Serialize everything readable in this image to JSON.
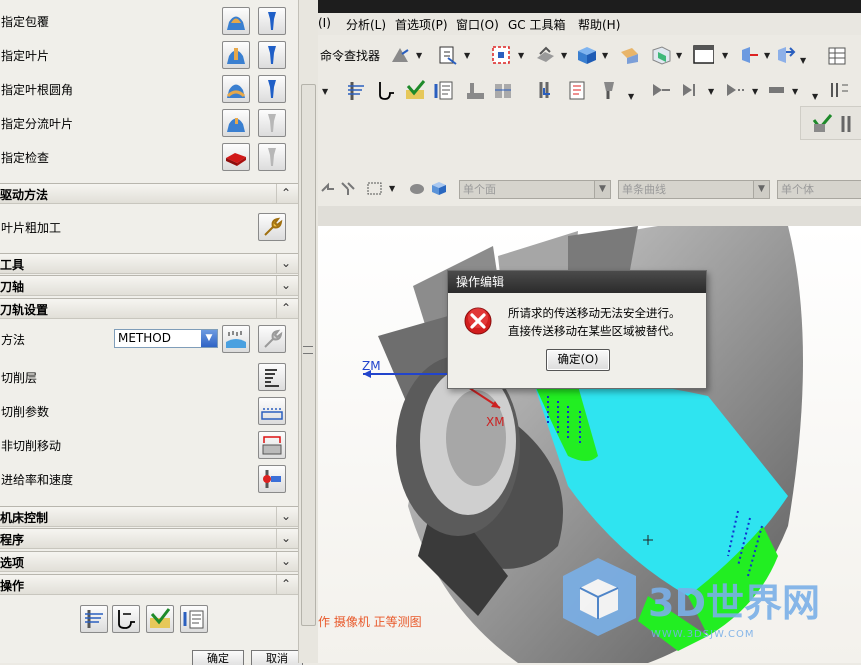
{
  "menubar": {
    "items": [
      "分析(L)",
      "首选项(P)",
      "窗口(O)",
      "GC 工具箱",
      "帮助(H)"
    ],
    "partial_item": "(I)"
  },
  "toolbar": {
    "command_finder": "命令查找器"
  },
  "selection_filter": {
    "face": "单个面",
    "curve": "单条曲线",
    "body": "单个体"
  },
  "left_panel": {
    "geometry_rows": [
      {
        "label": "指定包覆"
      },
      {
        "label": "指定叶片"
      },
      {
        "label": "指定叶根圆角"
      },
      {
        "label": "指定分流叶片"
      },
      {
        "label": "指定检查"
      }
    ],
    "drive_method": {
      "title": "驱动方法",
      "row_label": "叶片粗加工"
    },
    "tool": {
      "title": "工具"
    },
    "axis": {
      "title": "刀轴"
    },
    "path_settings": {
      "title": "刀轨设置",
      "method_label": "方法",
      "method_value": "METHOD",
      "rows": [
        {
          "label": "切削层"
        },
        {
          "label": "切削参数"
        },
        {
          "label": "非切削移动"
        },
        {
          "label": "进给率和速度"
        }
      ]
    },
    "machine_control": {
      "title": "机床控制"
    },
    "program": {
      "title": "程序"
    },
    "options": {
      "title": "选项"
    },
    "actions": {
      "title": "操作"
    }
  },
  "bottom_buttons": {
    "ok": "确定",
    "cancel": "取消"
  },
  "viewport": {
    "axis_zm": "ZM",
    "axis_xm": "XM",
    "status_text": "作 摄像机 正等测图"
  },
  "dialog": {
    "title": "操作编辑",
    "line1": "所请求的传送移动无法安全进行。",
    "line2": "直接传送移动在某些区域被替代。",
    "ok_label": "确定(O)"
  },
  "watermark": {
    "brand": "3D世界网",
    "url": "WWW.3DSJW.COM"
  }
}
